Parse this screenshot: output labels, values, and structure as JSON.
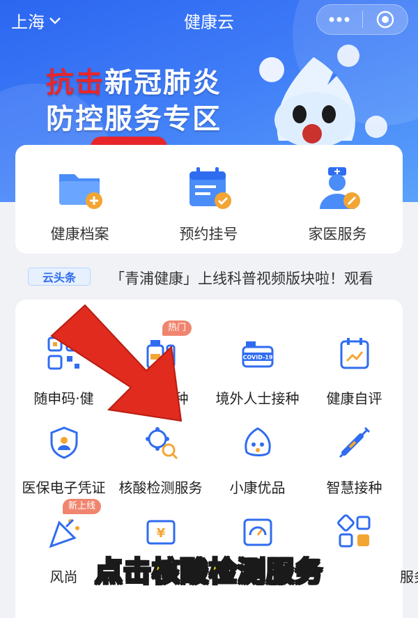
{
  "topbar": {
    "city": "上海",
    "title": "健康云"
  },
  "banner": {
    "line1_red": "抗击",
    "line1_rest": "新冠肺炎",
    "line2": "防控服务专区"
  },
  "quick": [
    {
      "label": "健康档案",
      "icon": "folder-plus-icon"
    },
    {
      "label": "预约挂号",
      "icon": "calendar-check-icon"
    },
    {
      "label": "家医服务",
      "icon": "doctor-icon"
    }
  ],
  "news": {
    "badge": "云头条",
    "text": "「青浦健康」上线科普视频版块啦！观看"
  },
  "services": [
    {
      "label": "随申码·健",
      "icon": "qr-code-icon"
    },
    {
      "label": "疫苗接种",
      "icon": "vaccine-bottle-icon",
      "tag": "热门"
    },
    {
      "label": "境外人士接种",
      "icon": "covid19-vaccine-icon"
    },
    {
      "label": "健康自评",
      "icon": "calendar-chart-icon"
    },
    {
      "label": "医保电子凭证",
      "icon": "shield-person-icon"
    },
    {
      "label": "核酸检测服务",
      "icon": "virus-search-icon"
    },
    {
      "label": "小康优品",
      "icon": "mascot-face-icon"
    },
    {
      "label": "智慧接种",
      "icon": "syringe-icon"
    },
    {
      "label": "风尚",
      "icon": "party-popper-icon",
      "tag": "新上线"
    },
    {
      "label": "",
      "icon": "yuan-card-icon"
    },
    {
      "label": "",
      "icon": "gauge-icon"
    },
    {
      "label": "服务",
      "icon": "grid-apps-icon"
    }
  ],
  "overlay": {
    "caption": "点击核酸检测服务"
  },
  "colors": {
    "primary": "#2f6cf0",
    "accent": "#f0a020",
    "red": "#e8262a",
    "caption": "#ffe500"
  }
}
